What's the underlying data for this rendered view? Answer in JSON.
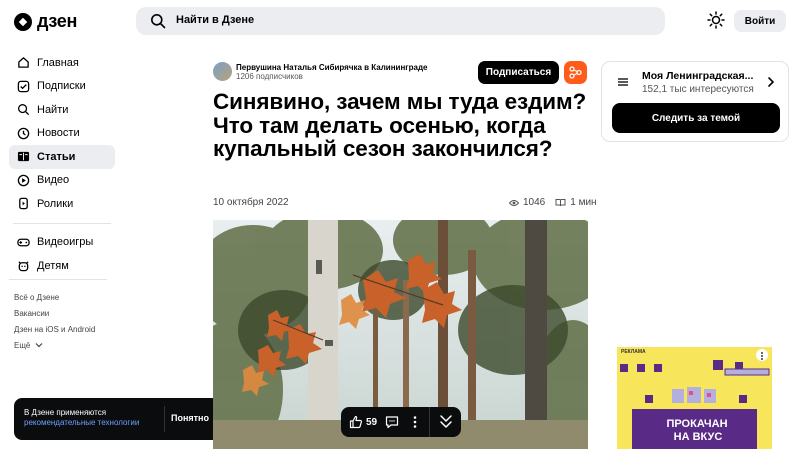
{
  "header": {
    "logo_text": "дзен",
    "search_placeholder": "Найти в Дзене",
    "login_label": "Войти"
  },
  "sidebar": {
    "items": [
      {
        "label": "Главная",
        "icon": "home-icon"
      },
      {
        "label": "Подписки",
        "icon": "subscriptions-icon"
      },
      {
        "label": "Найти",
        "icon": "search-icon"
      },
      {
        "label": "Новости",
        "icon": "news-icon"
      },
      {
        "label": "Статьи",
        "icon": "articles-icon",
        "active": true
      },
      {
        "label": "Видео",
        "icon": "video-icon"
      },
      {
        "label": "Ролики",
        "icon": "shorts-icon"
      }
    ],
    "items2": [
      {
        "label": "Видеоигры",
        "icon": "gamepad-icon"
      },
      {
        "label": "Детям",
        "icon": "kids-icon"
      }
    ],
    "footer_links": [
      "Всё о Дзене",
      "Вакансии",
      "Дзен на iOS и Android",
      "Ещё"
    ]
  },
  "cookie": {
    "text": "В Дзене применяются",
    "link": "рекомендательные технологии",
    "button": "Понятно"
  },
  "article": {
    "author_name": "Первушина Наталья Сибирячка в Калининграде",
    "author_subs": "1206 подписчиков",
    "subscribe_label": "Подписаться",
    "title": "Синявино, зачем мы туда ездим? Что там делать осенью, когда купальный сезон закончился?",
    "date": "10 октября 2022",
    "views": "1046",
    "read_time": "1 мин"
  },
  "reactions": {
    "likes": "59"
  },
  "theme_card": {
    "name": "Моя Ленинградская...",
    "subs": "152,1 тыс интересуются",
    "follow_label": "Следить за темой"
  },
  "ad": {
    "label": "РЕКЛАМА",
    "line1": "ПРОКАЧАН",
    "line2": "НА ВКУС"
  },
  "colors": {
    "accent_orange": "#ff5c1a",
    "bg_gray": "#ebedf0",
    "dark": "#0b0c0e",
    "ad_yellow": "#f7e55c",
    "ad_purple": "#5a2b86"
  }
}
